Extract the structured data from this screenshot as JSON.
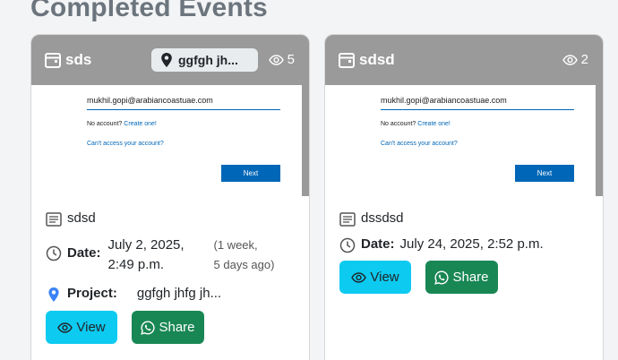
{
  "section_title": "Completed Events",
  "events": [
    {
      "title": "sds",
      "project_pill": "ggfgh jh...",
      "views": "5",
      "preview": {
        "email": "mukhil.gopi@arabiancoastuae.com",
        "no_account": "No account?",
        "create_one": "Create one!",
        "cant_access": "Can't access your account?",
        "next": "Next"
      },
      "description": "sdsd",
      "date_label": "Date:",
      "date_line1": "July 2, 2025,",
      "date_line2": "2:49 p.m.",
      "ago_line1": "(1 week,",
      "ago_line2": "5 days ago)",
      "project_label": "Project:",
      "project_value": "ggfgh jhfg jh...",
      "view_label": "View",
      "share_label": "Share"
    },
    {
      "title": "sdsd",
      "views": "2",
      "preview": {
        "email": "mukhil.gopi@arabiancoastuae.com",
        "no_account": "No account?",
        "create_one": "Create one!",
        "cant_access": "Can't access your account?",
        "next": "Next"
      },
      "description": "dssdsd",
      "date_label": "Date:",
      "date_value": "July 24, 2025, 2:52 p.m.",
      "view_label": "View",
      "share_label": "Share"
    }
  ],
  "colors": {
    "view_button": "#0dcaf0",
    "share_button": "#198754",
    "header_overlay": "#9a9a9a",
    "link_blue": "#0067b8"
  },
  "icons": [
    "calendar-icon",
    "map-pin-icon",
    "eye-icon",
    "text-lines-icon",
    "clock-icon",
    "whatsapp-icon"
  ]
}
